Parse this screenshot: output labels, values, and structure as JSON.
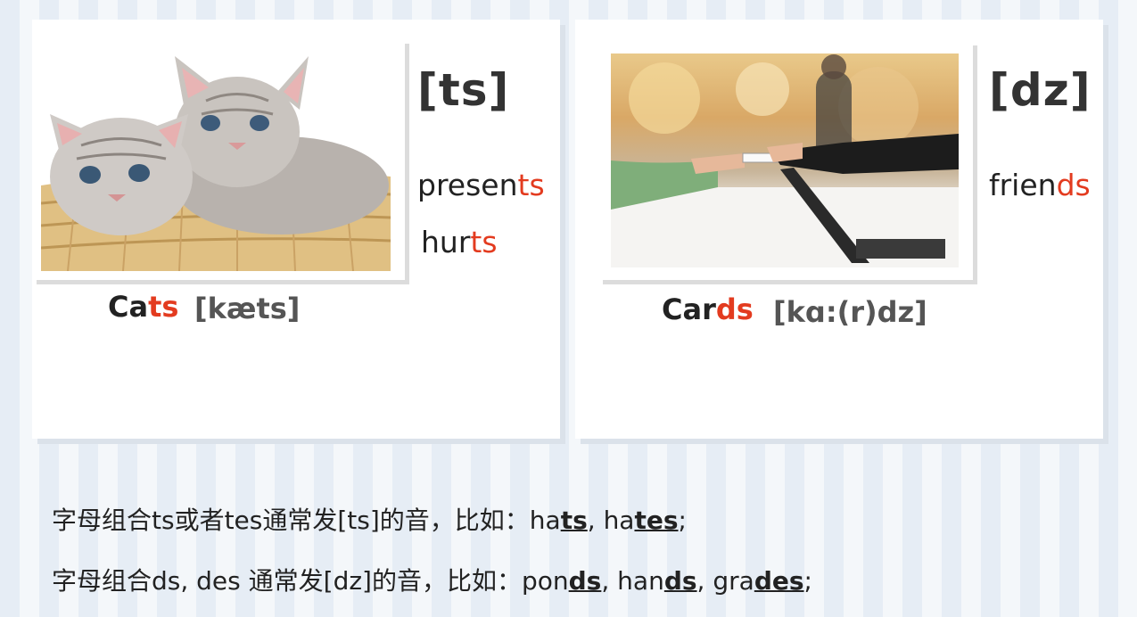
{
  "left_card": {
    "phoneme": "[ts]",
    "words": [
      {
        "base": "presen",
        "highlight": "ts"
      },
      {
        "base": "hur",
        "highlight": "ts"
      }
    ],
    "caption": {
      "base": "Ca",
      "highlight": "ts",
      "phonetic": "[kæts]"
    }
  },
  "right_card": {
    "phoneme": "[dz]",
    "words": [
      {
        "base": "frien",
        "highlight": "ds"
      }
    ],
    "caption": {
      "base": "Car",
      "highlight": "ds",
      "phonetic": "[kɑ:(r)dz]"
    }
  },
  "rules": [
    {
      "prefix": "字母组合ts或者tes通常发[ts]的音，比如：",
      "examples": [
        {
          "base": "ha",
          "ending": "ts",
          "sep": ", "
        },
        {
          "base": "ha",
          "ending": "tes",
          "sep": ";"
        }
      ]
    },
    {
      "prefix": "字母组合ds, des 通常发[dz]的音，比如：",
      "examples": [
        {
          "base": "pon",
          "ending": "ds",
          "sep": ", "
        },
        {
          "base": "han",
          "ending": "ds",
          "sep": ", "
        },
        {
          "base": "gra",
          "ending": "des",
          "sep": ";"
        }
      ]
    }
  ],
  "colors": {
    "highlight": "#e33b1f",
    "card_bg": "#ffffff",
    "stripe_light": "#f4f7fa",
    "stripe_dark": "#e6edf5"
  },
  "images": [
    "kittens-in-basket",
    "card-payment-at-counter"
  ]
}
